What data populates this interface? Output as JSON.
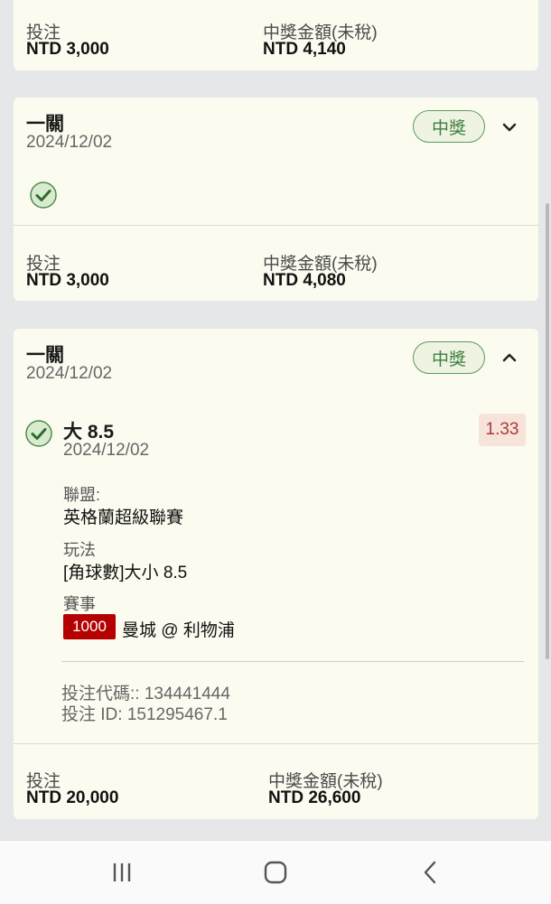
{
  "card1": {
    "stake_label": "投注",
    "stake_value": "NTD 3,000",
    "win_label": "中獎金額(未稅)",
    "win_value": "NTD 4,140"
  },
  "card2": {
    "title": "一關",
    "date": "2024/12/02",
    "status": "中獎",
    "stake_label": "投注",
    "stake_value": "NTD 3,000",
    "win_label": "中獎金額(未稅)",
    "win_value": "NTD 4,080"
  },
  "card3": {
    "title": "一關",
    "date": "2024/12/02",
    "status": "中獎",
    "selection": {
      "name": "大 8.5",
      "date": "2024/12/02",
      "odds": "1.33",
      "league_label": "聯盟:",
      "league_value": "英格蘭超級聯賽",
      "market_label": "玩法",
      "market_value": "[角球數]大小 8.5",
      "event_label": "賽事",
      "event_code": "1000",
      "event_value": "曼城 @ 利物浦"
    },
    "bet_code": "投注代碼:: 134441444",
    "bet_id": "投注 ID: 151295467.1",
    "stake_label": "投注",
    "stake_value": "NTD 20,000",
    "win_label": "中獎金額(未稅)",
    "win_value": "NTD 26,600"
  },
  "colors": {
    "win_green": "#3f7e3f",
    "odds_red": "#b03a3a",
    "event_badge_red": "#b40000",
    "card_bg": "#fcfbf0"
  },
  "icons": {
    "check": "check-circle-icon",
    "expand": "chevron-down-icon",
    "collapse": "chevron-up-icon",
    "nav_recent": "recent-apps-icon",
    "nav_home": "home-icon",
    "nav_back": "back-icon"
  }
}
